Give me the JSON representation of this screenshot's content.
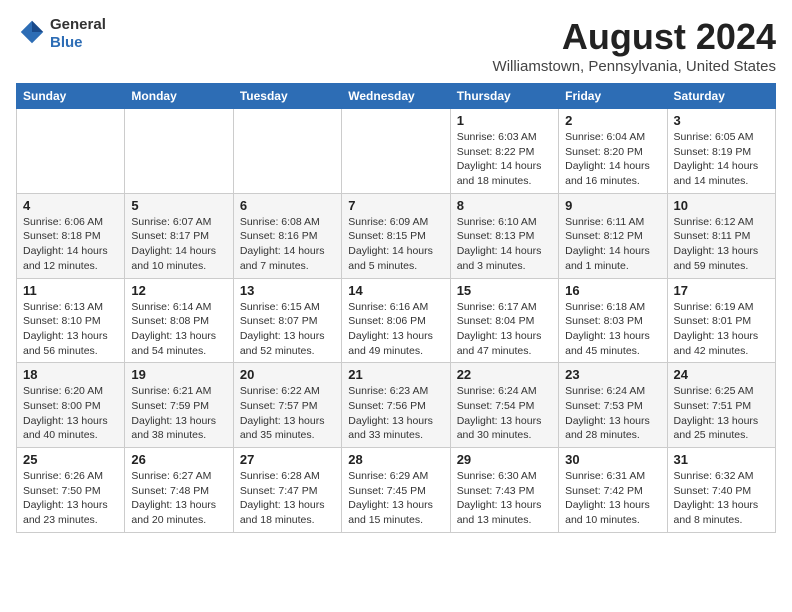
{
  "logo": {
    "line1": "General",
    "line2": "Blue"
  },
  "title": "August 2024",
  "subtitle": "Williamstown, Pennsylvania, United States",
  "days_of_week": [
    "Sunday",
    "Monday",
    "Tuesday",
    "Wednesday",
    "Thursday",
    "Friday",
    "Saturday"
  ],
  "weeks": [
    [
      {
        "day": "",
        "info": ""
      },
      {
        "day": "",
        "info": ""
      },
      {
        "day": "",
        "info": ""
      },
      {
        "day": "",
        "info": ""
      },
      {
        "day": "1",
        "info": "Sunrise: 6:03 AM\nSunset: 8:22 PM\nDaylight: 14 hours\nand 18 minutes."
      },
      {
        "day": "2",
        "info": "Sunrise: 6:04 AM\nSunset: 8:20 PM\nDaylight: 14 hours\nand 16 minutes."
      },
      {
        "day": "3",
        "info": "Sunrise: 6:05 AM\nSunset: 8:19 PM\nDaylight: 14 hours\nand 14 minutes."
      }
    ],
    [
      {
        "day": "4",
        "info": "Sunrise: 6:06 AM\nSunset: 8:18 PM\nDaylight: 14 hours\nand 12 minutes."
      },
      {
        "day": "5",
        "info": "Sunrise: 6:07 AM\nSunset: 8:17 PM\nDaylight: 14 hours\nand 10 minutes."
      },
      {
        "day": "6",
        "info": "Sunrise: 6:08 AM\nSunset: 8:16 PM\nDaylight: 14 hours\nand 7 minutes."
      },
      {
        "day": "7",
        "info": "Sunrise: 6:09 AM\nSunset: 8:15 PM\nDaylight: 14 hours\nand 5 minutes."
      },
      {
        "day": "8",
        "info": "Sunrise: 6:10 AM\nSunset: 8:13 PM\nDaylight: 14 hours\nand 3 minutes."
      },
      {
        "day": "9",
        "info": "Sunrise: 6:11 AM\nSunset: 8:12 PM\nDaylight: 14 hours\nand 1 minute."
      },
      {
        "day": "10",
        "info": "Sunrise: 6:12 AM\nSunset: 8:11 PM\nDaylight: 13 hours\nand 59 minutes."
      }
    ],
    [
      {
        "day": "11",
        "info": "Sunrise: 6:13 AM\nSunset: 8:10 PM\nDaylight: 13 hours\nand 56 minutes."
      },
      {
        "day": "12",
        "info": "Sunrise: 6:14 AM\nSunset: 8:08 PM\nDaylight: 13 hours\nand 54 minutes."
      },
      {
        "day": "13",
        "info": "Sunrise: 6:15 AM\nSunset: 8:07 PM\nDaylight: 13 hours\nand 52 minutes."
      },
      {
        "day": "14",
        "info": "Sunrise: 6:16 AM\nSunset: 8:06 PM\nDaylight: 13 hours\nand 49 minutes."
      },
      {
        "day": "15",
        "info": "Sunrise: 6:17 AM\nSunset: 8:04 PM\nDaylight: 13 hours\nand 47 minutes."
      },
      {
        "day": "16",
        "info": "Sunrise: 6:18 AM\nSunset: 8:03 PM\nDaylight: 13 hours\nand 45 minutes."
      },
      {
        "day": "17",
        "info": "Sunrise: 6:19 AM\nSunset: 8:01 PM\nDaylight: 13 hours\nand 42 minutes."
      }
    ],
    [
      {
        "day": "18",
        "info": "Sunrise: 6:20 AM\nSunset: 8:00 PM\nDaylight: 13 hours\nand 40 minutes."
      },
      {
        "day": "19",
        "info": "Sunrise: 6:21 AM\nSunset: 7:59 PM\nDaylight: 13 hours\nand 38 minutes."
      },
      {
        "day": "20",
        "info": "Sunrise: 6:22 AM\nSunset: 7:57 PM\nDaylight: 13 hours\nand 35 minutes."
      },
      {
        "day": "21",
        "info": "Sunrise: 6:23 AM\nSunset: 7:56 PM\nDaylight: 13 hours\nand 33 minutes."
      },
      {
        "day": "22",
        "info": "Sunrise: 6:24 AM\nSunset: 7:54 PM\nDaylight: 13 hours\nand 30 minutes."
      },
      {
        "day": "23",
        "info": "Sunrise: 6:24 AM\nSunset: 7:53 PM\nDaylight: 13 hours\nand 28 minutes."
      },
      {
        "day": "24",
        "info": "Sunrise: 6:25 AM\nSunset: 7:51 PM\nDaylight: 13 hours\nand 25 minutes."
      }
    ],
    [
      {
        "day": "25",
        "info": "Sunrise: 6:26 AM\nSunset: 7:50 PM\nDaylight: 13 hours\nand 23 minutes."
      },
      {
        "day": "26",
        "info": "Sunrise: 6:27 AM\nSunset: 7:48 PM\nDaylight: 13 hours\nand 20 minutes."
      },
      {
        "day": "27",
        "info": "Sunrise: 6:28 AM\nSunset: 7:47 PM\nDaylight: 13 hours\nand 18 minutes."
      },
      {
        "day": "28",
        "info": "Sunrise: 6:29 AM\nSunset: 7:45 PM\nDaylight: 13 hours\nand 15 minutes."
      },
      {
        "day": "29",
        "info": "Sunrise: 6:30 AM\nSunset: 7:43 PM\nDaylight: 13 hours\nand 13 minutes."
      },
      {
        "day": "30",
        "info": "Sunrise: 6:31 AM\nSunset: 7:42 PM\nDaylight: 13 hours\nand 10 minutes."
      },
      {
        "day": "31",
        "info": "Sunrise: 6:32 AM\nSunset: 7:40 PM\nDaylight: 13 hours\nand 8 minutes."
      }
    ]
  ],
  "colors": {
    "header_bg": "#2d6db5",
    "header_text": "#ffffff",
    "accent": "#2d6db5"
  }
}
